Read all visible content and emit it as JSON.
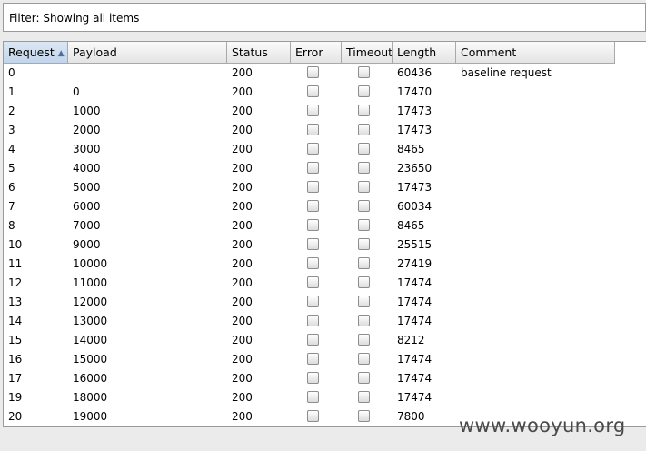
{
  "filter": {
    "text": "Filter: Showing all items"
  },
  "table": {
    "columns": [
      {
        "key": "request",
        "label": "Request"
      },
      {
        "key": "payload",
        "label": "Payload"
      },
      {
        "key": "status",
        "label": "Status"
      },
      {
        "key": "error",
        "label": "Error"
      },
      {
        "key": "timeout",
        "label": "Timeout"
      },
      {
        "key": "length",
        "label": "Length"
      },
      {
        "key": "comment",
        "label": "Comment"
      }
    ],
    "sort": {
      "column": "request",
      "direction": "ascending",
      "indicator": "▲"
    },
    "rows": [
      {
        "request": "0",
        "payload": "",
        "status": "200",
        "error": false,
        "timeout": false,
        "length": "60436",
        "comment": "baseline request"
      },
      {
        "request": "1",
        "payload": "0",
        "status": "200",
        "error": false,
        "timeout": false,
        "length": "17470",
        "comment": ""
      },
      {
        "request": "2",
        "payload": "1000",
        "status": "200",
        "error": false,
        "timeout": false,
        "length": "17473",
        "comment": ""
      },
      {
        "request": "3",
        "payload": "2000",
        "status": "200",
        "error": false,
        "timeout": false,
        "length": "17473",
        "comment": ""
      },
      {
        "request": "4",
        "payload": "3000",
        "status": "200",
        "error": false,
        "timeout": false,
        "length": "8465",
        "comment": ""
      },
      {
        "request": "5",
        "payload": "4000",
        "status": "200",
        "error": false,
        "timeout": false,
        "length": "23650",
        "comment": ""
      },
      {
        "request": "6",
        "payload": "5000",
        "status": "200",
        "error": false,
        "timeout": false,
        "length": "17473",
        "comment": ""
      },
      {
        "request": "7",
        "payload": "6000",
        "status": "200",
        "error": false,
        "timeout": false,
        "length": "60034",
        "comment": ""
      },
      {
        "request": "8",
        "payload": "7000",
        "status": "200",
        "error": false,
        "timeout": false,
        "length": "8465",
        "comment": ""
      },
      {
        "request": "10",
        "payload": "9000",
        "status": "200",
        "error": false,
        "timeout": false,
        "length": "25515",
        "comment": ""
      },
      {
        "request": "11",
        "payload": "10000",
        "status": "200",
        "error": false,
        "timeout": false,
        "length": "27419",
        "comment": ""
      },
      {
        "request": "12",
        "payload": "11000",
        "status": "200",
        "error": false,
        "timeout": false,
        "length": "17474",
        "comment": ""
      },
      {
        "request": "13",
        "payload": "12000",
        "status": "200",
        "error": false,
        "timeout": false,
        "length": "17474",
        "comment": ""
      },
      {
        "request": "14",
        "payload": "13000",
        "status": "200",
        "error": false,
        "timeout": false,
        "length": "17474",
        "comment": ""
      },
      {
        "request": "15",
        "payload": "14000",
        "status": "200",
        "error": false,
        "timeout": false,
        "length": "8212",
        "comment": ""
      },
      {
        "request": "16",
        "payload": "15000",
        "status": "200",
        "error": false,
        "timeout": false,
        "length": "17474",
        "comment": ""
      },
      {
        "request": "17",
        "payload": "16000",
        "status": "200",
        "error": false,
        "timeout": false,
        "length": "17474",
        "comment": ""
      },
      {
        "request": "19",
        "payload": "18000",
        "status": "200",
        "error": false,
        "timeout": false,
        "length": "17474",
        "comment": ""
      },
      {
        "request": "20",
        "payload": "19000",
        "status": "200",
        "error": false,
        "timeout": false,
        "length": "7800",
        "comment": ""
      }
    ]
  },
  "watermark": {
    "text": "www.wooyun.org"
  }
}
